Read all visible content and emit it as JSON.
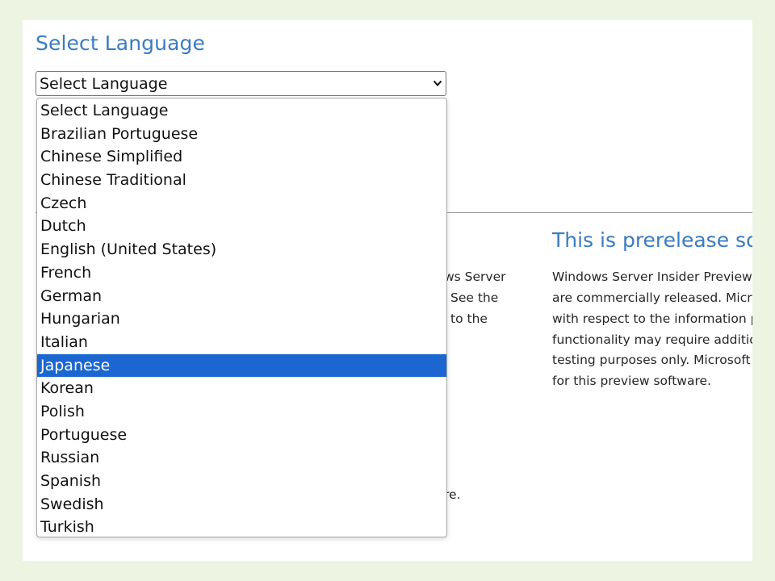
{
  "colors": {
    "outer_background": "#eef4e2",
    "heading": "#3a7cc0",
    "highlight": "#1b66d1"
  },
  "form": {
    "heading": "Select Language",
    "select": {
      "value": "Select Language",
      "chevron_icon": "chevron-down-icon"
    }
  },
  "dropdown": {
    "options": [
      {
        "label": "Select Language",
        "highlighted": false
      },
      {
        "label": "Brazilian Portuguese",
        "highlighted": false
      },
      {
        "label": "Chinese Simplified",
        "highlighted": false
      },
      {
        "label": "Chinese Traditional",
        "highlighted": false
      },
      {
        "label": "Czech",
        "highlighted": false
      },
      {
        "label": "Dutch",
        "highlighted": false
      },
      {
        "label": "English (United States)",
        "highlighted": false
      },
      {
        "label": "French",
        "highlighted": false
      },
      {
        "label": "German",
        "highlighted": false
      },
      {
        "label": "Hungarian",
        "highlighted": false
      },
      {
        "label": "Italian",
        "highlighted": false
      },
      {
        "label": "Japanese",
        "highlighted": true
      },
      {
        "label": "Korean",
        "highlighted": false
      },
      {
        "label": "Polish",
        "highlighted": false
      },
      {
        "label": "Portuguese",
        "highlighted": false
      },
      {
        "label": "Russian",
        "highlighted": false
      },
      {
        "label": "Spanish",
        "highlighted": false
      },
      {
        "label": "Swedish",
        "highlighted": false
      },
      {
        "label": "Turkish",
        "highlighted": false
      }
    ]
  },
  "left_column_fragments": [
    "ws Server",
    "See the",
    "to the",
    "re."
  ],
  "notice": {
    "title": "This is prerelease soft",
    "lines": [
      "Windows Server Insider Preview b",
      "are commercially released. Micros",
      "with respect to the information p",
      "functionality may require additio",
      "testing purposes only. Microsoft",
      "for this preview software."
    ]
  }
}
